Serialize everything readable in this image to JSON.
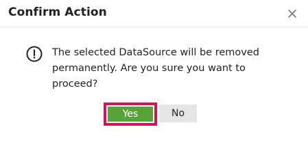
{
  "dialog": {
    "title": "Confirm Action",
    "close_icon": "close-icon",
    "info_icon": "info-circle-icon",
    "message": "The selected DataSource will be removed permanently. Are you sure you want to proceed?",
    "yes_label": "Yes",
    "no_label": "No"
  },
  "colors": {
    "yes_button": "#58a23a",
    "yes_focus_outline": "#d4145a",
    "no_button": "#e4e6e4",
    "text": "#222222"
  }
}
